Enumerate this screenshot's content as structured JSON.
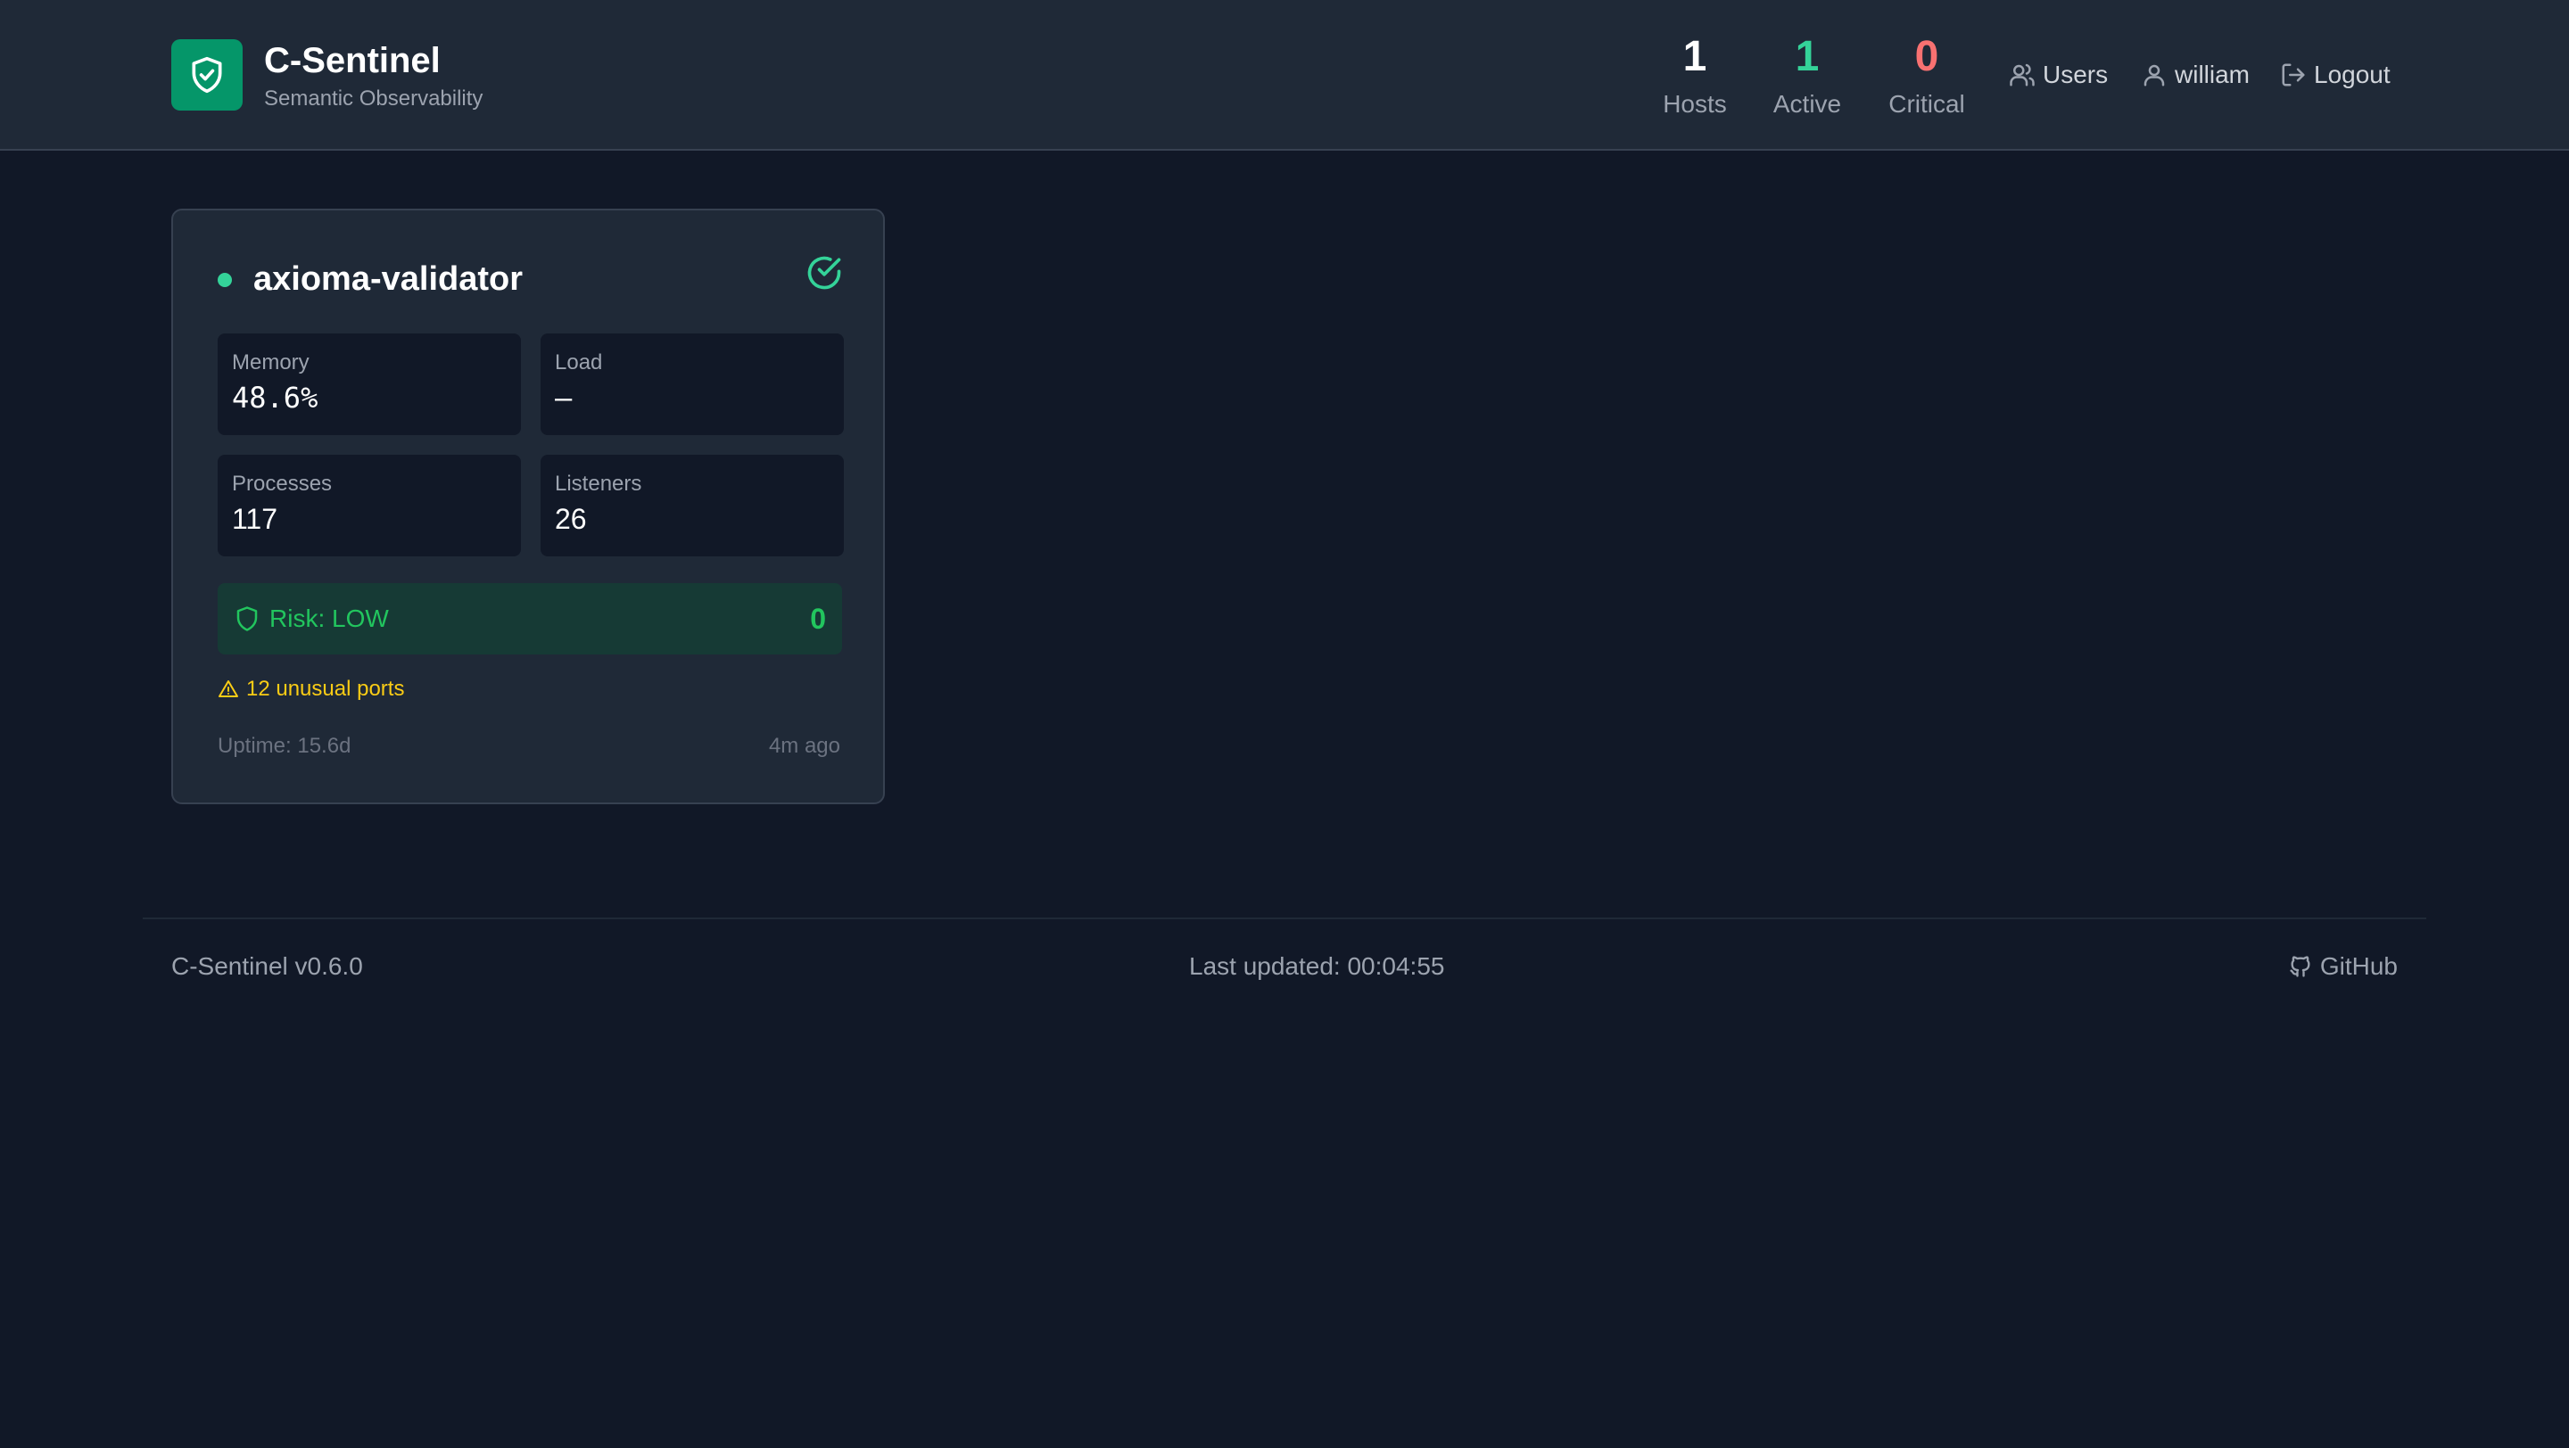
{
  "header": {
    "title": "C-Sentinel",
    "subtitle": "Semantic Observability",
    "stats": [
      {
        "value": "1",
        "label": "Hosts",
        "color": "#ffffff"
      },
      {
        "value": "1",
        "label": "Active",
        "color": "#34d399"
      },
      {
        "value": "0",
        "label": "Critical",
        "color": "#f87171"
      }
    ],
    "nav": {
      "users": "Users",
      "user": "william",
      "logout": "Logout"
    }
  },
  "host_card": {
    "name": "axioma-validator",
    "status": "online",
    "metrics": {
      "memory": {
        "label": "Memory",
        "value": "48.6%"
      },
      "load": {
        "label": "Load",
        "value": "–"
      },
      "processes": {
        "label": "Processes",
        "value": "117"
      },
      "listeners": {
        "label": "Listeners",
        "value": "26"
      }
    },
    "risk": {
      "label": "Risk: LOW",
      "score": "0"
    },
    "warning": "12 unusual ports",
    "uptime": "Uptime: 15.6d",
    "last_seen": "4m ago"
  },
  "footer": {
    "version": "C-Sentinel v0.6.0",
    "last_updated": "Last updated: 00:04:55",
    "github": "GitHub"
  },
  "colors": {
    "background": "#111827",
    "panel": "#1f2937",
    "accent": "#059669",
    "ok": "#22c55e",
    "warn": "#facc15",
    "critical": "#f87171"
  }
}
